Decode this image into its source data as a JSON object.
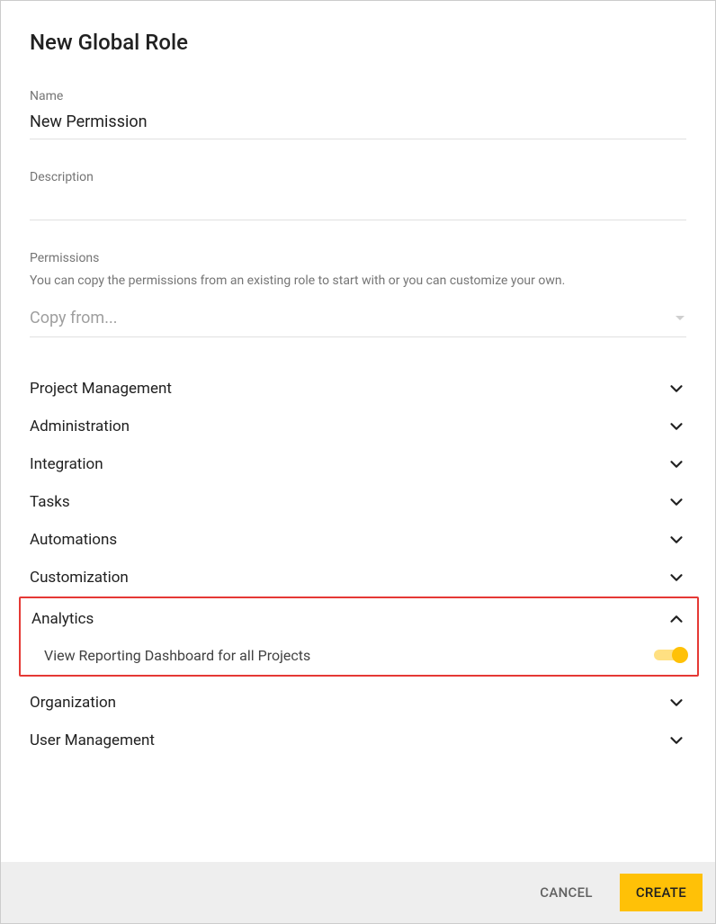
{
  "title": "New Global Role",
  "fields": {
    "name_label": "Name",
    "name_value": "New Permission",
    "description_label": "Description",
    "description_value": ""
  },
  "permissions": {
    "section_label": "Permissions",
    "hint": "You can copy the permissions from an existing role to start with or you can customize your own.",
    "copy_placeholder": "Copy from...",
    "groups": [
      {
        "label": "Project Management",
        "expanded": false
      },
      {
        "label": "Administration",
        "expanded": false
      },
      {
        "label": "Integration",
        "expanded": false
      },
      {
        "label": "Tasks",
        "expanded": false
      },
      {
        "label": "Automations",
        "expanded": false
      },
      {
        "label": "Customization",
        "expanded": false
      },
      {
        "label": "Analytics",
        "expanded": true,
        "highlighted": true,
        "items": [
          {
            "label": "View Reporting Dashboard for all Projects",
            "enabled": true
          }
        ]
      },
      {
        "label": "Organization",
        "expanded": false
      },
      {
        "label": "User Management",
        "expanded": false
      }
    ]
  },
  "buttons": {
    "cancel": "CANCEL",
    "create": "CREATE"
  }
}
